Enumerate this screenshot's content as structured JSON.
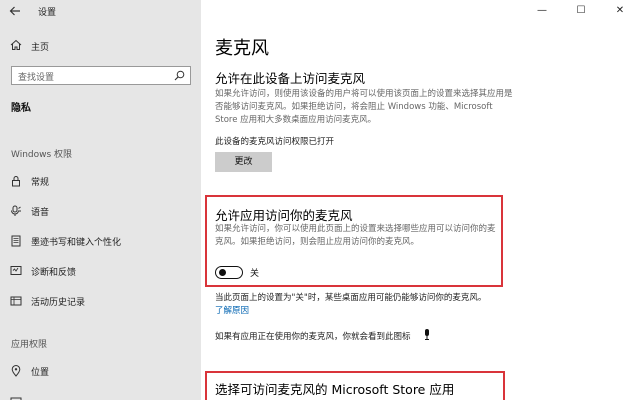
{
  "window": {
    "app_title": "设置",
    "minimize": "—",
    "maximize": "☐",
    "close": "✕"
  },
  "sidebar": {
    "home_label": "主页",
    "search_placeholder": "查找设置",
    "section_title": "隐私",
    "groups": [
      {
        "label": "Windows 权限"
      },
      {
        "label": "应用权限"
      }
    ],
    "windows_items": [
      {
        "label": "常规"
      },
      {
        "label": "语音"
      },
      {
        "label": "墨迹书写和键入个性化"
      },
      {
        "label": "诊断和反馈"
      },
      {
        "label": "活动历史记录"
      }
    ],
    "app_items": [
      {
        "label": "位置"
      }
    ]
  },
  "main": {
    "page_title": "麦克风",
    "device_section": {
      "heading": "允许在此设备上访问麦克风",
      "description": "如果允许访问，则使用该设备的用户将可以使用该页面上的设置来选择其应用是否能够访问麦克风。如果拒绝访问，将会阻止 Windows 功能、Microsoft Store 应用和大多数桌面应用访问麦克风。",
      "status": "此设备的麦克风访问权限已打开",
      "change_button": "更改"
    },
    "app_section": {
      "heading": "允许应用访问你的麦克风",
      "description": "如果允许访问，你可以使用此页面上的设置来选择哪些应用可以访问你的麦克风。如果拒绝访问，则会阻止应用访问你的麦克风。",
      "toggle_state": "关",
      "toggle_on": false
    },
    "note": "当此页面上的设置为\"关\"时，某些桌面应用可能仍能够访问你的麦克风。",
    "learn_more": "了解原因",
    "indicator_note": "如果有应用正在使用你的麦克风，你就会看到此图标",
    "store_section": {
      "heading": "选择可访问麦克风的 Microsoft Store 应用"
    }
  }
}
